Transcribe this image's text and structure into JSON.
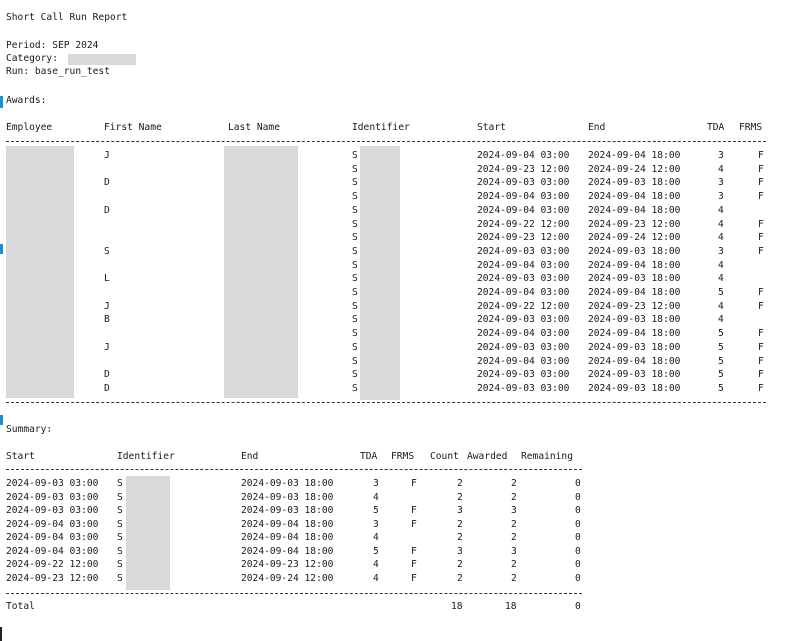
{
  "report": {
    "title": "Short Call Run Report",
    "period_label": "Period:",
    "period_value": "SEP 2024",
    "category_label": "Category:",
    "run_label": "Run:",
    "run_value": "base_run_test"
  },
  "awards": {
    "heading": "Awards:",
    "columns": [
      "Employee",
      "First Name",
      "Last Name",
      "Identifier",
      "Start",
      "End",
      "TDA",
      "FRMS"
    ],
    "rows": [
      {
        "first": "J",
        "id": "S",
        "start": "2024-09-04 03:00",
        "end": "2024-09-04 18:00",
        "tda": "3",
        "frms": "F"
      },
      {
        "first": "",
        "id": "S",
        "start": "2024-09-23 12:00",
        "end": "2024-09-24 12:00",
        "tda": "4",
        "frms": "F"
      },
      {
        "first": "D",
        "id": "S",
        "start": "2024-09-03 03:00",
        "end": "2024-09-03 18:00",
        "tda": "3",
        "frms": "F"
      },
      {
        "first": "",
        "id": "S",
        "start": "2024-09-04 03:00",
        "end": "2024-09-04 18:00",
        "tda": "3",
        "frms": "F"
      },
      {
        "first": "D",
        "id": "S",
        "start": "2024-09-04 03:00",
        "end": "2024-09-04 18:00",
        "tda": "4",
        "frms": ""
      },
      {
        "first": "",
        "id": "S",
        "start": "2024-09-22 12:00",
        "end": "2024-09-23 12:00",
        "tda": "4",
        "frms": "F"
      },
      {
        "first": "",
        "id": "S",
        "start": "2024-09-23 12:00",
        "end": "2024-09-24 12:00",
        "tda": "4",
        "frms": "F"
      },
      {
        "first": "S",
        "id": "S",
        "start": "2024-09-03 03:00",
        "end": "2024-09-03 18:00",
        "tda": "3",
        "frms": "F"
      },
      {
        "first": "",
        "id": "S",
        "start": "2024-09-04 03:00",
        "end": "2024-09-04 18:00",
        "tda": "4",
        "frms": ""
      },
      {
        "first": "L",
        "id": "S",
        "start": "2024-09-03 03:00",
        "end": "2024-09-03 18:00",
        "tda": "4",
        "frms": ""
      },
      {
        "first": "",
        "id": "S",
        "start": "2024-09-04 03:00",
        "end": "2024-09-04 18:00",
        "tda": "5",
        "frms": "F"
      },
      {
        "first": "J",
        "id": "S",
        "start": "2024-09-22 12:00",
        "end": "2024-09-23 12:00",
        "tda": "4",
        "frms": "F"
      },
      {
        "first": "B",
        "id": "S",
        "start": "2024-09-03 03:00",
        "end": "2024-09-03 18:00",
        "tda": "4",
        "frms": ""
      },
      {
        "first": "",
        "id": "S",
        "start": "2024-09-04 03:00",
        "end": "2024-09-04 18:00",
        "tda": "5",
        "frms": "F"
      },
      {
        "first": "J",
        "id": "S",
        "start": "2024-09-03 03:00",
        "end": "2024-09-03 18:00",
        "tda": "5",
        "frms": "F"
      },
      {
        "first": "",
        "id": "S",
        "start": "2024-09-04 03:00",
        "end": "2024-09-04 18:00",
        "tda": "5",
        "frms": "F"
      },
      {
        "first": "D",
        "id": "S",
        "start": "2024-09-03 03:00",
        "end": "2024-09-03 18:00",
        "tda": "5",
        "frms": "F"
      },
      {
        "first": "D",
        "id": "S",
        "start": "2024-09-03 03:00",
        "end": "2024-09-03 18:00",
        "tda": "5",
        "frms": "F"
      }
    ]
  },
  "summary": {
    "heading": "Summary:",
    "columns": [
      "Start",
      "Identifier",
      "End",
      "TDA",
      "FRMS",
      "Count",
      "Awarded",
      "Remaining"
    ],
    "rows": [
      {
        "start": "2024-09-03 03:00",
        "id": "S",
        "end": "2024-09-03 18:00",
        "tda": "3",
        "frms": "F",
        "count": "2",
        "awarded": "2",
        "remaining": "0"
      },
      {
        "start": "2024-09-03 03:00",
        "id": "S",
        "end": "2024-09-03 18:00",
        "tda": "4",
        "frms": "",
        "count": "2",
        "awarded": "2",
        "remaining": "0"
      },
      {
        "start": "2024-09-03 03:00",
        "id": "S",
        "end": "2024-09-03 18:00",
        "tda": "5",
        "frms": "F",
        "count": "3",
        "awarded": "3",
        "remaining": "0"
      },
      {
        "start": "2024-09-04 03:00",
        "id": "S",
        "end": "2024-09-04 18:00",
        "tda": "3",
        "frms": "F",
        "count": "2",
        "awarded": "2",
        "remaining": "0"
      },
      {
        "start": "2024-09-04 03:00",
        "id": "S",
        "end": "2024-09-04 18:00",
        "tda": "4",
        "frms": "",
        "count": "2",
        "awarded": "2",
        "remaining": "0"
      },
      {
        "start": "2024-09-04 03:00",
        "id": "S",
        "end": "2024-09-04 18:00",
        "tda": "5",
        "frms": "F",
        "count": "3",
        "awarded": "3",
        "remaining": "0"
      },
      {
        "start": "2024-09-22 12:00",
        "id": "S",
        "end": "2024-09-23 12:00",
        "tda": "4",
        "frms": "F",
        "count": "2",
        "awarded": "2",
        "remaining": "0"
      },
      {
        "start": "2024-09-23 12:00",
        "id": "S",
        "end": "2024-09-24 12:00",
        "tda": "4",
        "frms": "F",
        "count": "2",
        "awarded": "2",
        "remaining": "0"
      }
    ],
    "total_label": "Total",
    "total_count": "18",
    "total_awarded": "18",
    "total_remaining": "0"
  },
  "colors": {
    "text": "#1a1a1a",
    "redaction": "#d9d9d9",
    "window_edge": "#1a8fd6"
  }
}
